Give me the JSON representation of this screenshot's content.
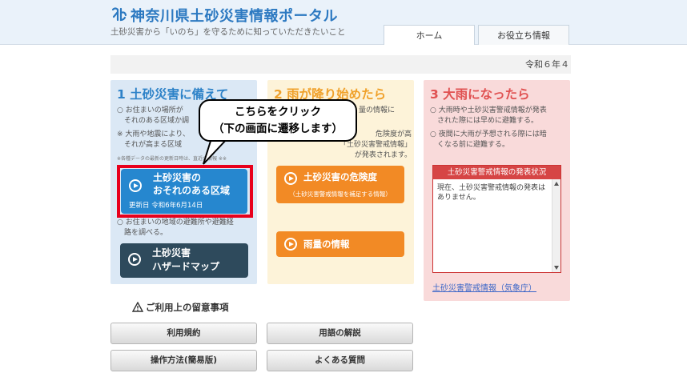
{
  "header": {
    "logo_glyph": "卿",
    "title": "神奈川県土砂災害情報ポータル",
    "subtitle": "土砂災害から「いのち」を守るために知っていただきたいこと",
    "tabs": [
      {
        "label": "ホーム"
      },
      {
        "label": "お役立ち情報"
      }
    ]
  },
  "date_bar": {
    "text": "令和６年４"
  },
  "col1": {
    "heading": "1 土砂災害に備えて",
    "text1": "○ お住まいの場所が\n　それのある区域か調",
    "text2": "※ 大雨や地震により、\n　それが高まる区域",
    "text3": "※各種データの最新の更新日時は、直近の情報 ※※",
    "area_button": {
      "line1": "土砂災害の",
      "line2": "おそれのある区域",
      "updated": "更新日 令和6年6月14日"
    },
    "text4": "○ お住まいの地域の避難所や避難経\n　路を調べる。",
    "hazard_button": {
      "line1": "土砂災害",
      "line2": "ハザードマップ"
    }
  },
  "col2": {
    "heading": "2 雨が降り始めたら",
    "text1": "量の情報に",
    "text2": "危険度が高\n「土砂災害警戒情報」\n　が発表されます。",
    "risk_button": {
      "line1": "土砂災害の危険度",
      "line2": "（土砂災害警戒情報を補足する情報）"
    },
    "rain_button": {
      "label": "雨量の情報"
    }
  },
  "col3": {
    "heading": "3 大雨になったら",
    "text1": "○ 大雨時や土砂災害警戒情報が発表\n　された際には早めに避難する。",
    "text2": "○ 夜間に大雨が予想される際には暗\n　くなる前に避難する。",
    "warn_title": "土砂災害警戒情報の発表状況",
    "warn_body": "現在、土砂災害警戒情報の発表はありません。",
    "warn_link": "土砂災害警戒情報（気象庁）"
  },
  "callout": {
    "line1": "こちらをクリック",
    "line2": "（下の画面に遷移します）"
  },
  "notice": {
    "heading": "ご利用上の留意事項",
    "buttons": [
      "利用規約",
      "用語の解説",
      "操作方法(簡易版)",
      "よくある質問"
    ]
  },
  "colors": {
    "brand_blue": "#2c79c1",
    "highlight_red": "#e8001c",
    "orange": "#f28a25",
    "hazard_dark": "#2e4a5c"
  }
}
